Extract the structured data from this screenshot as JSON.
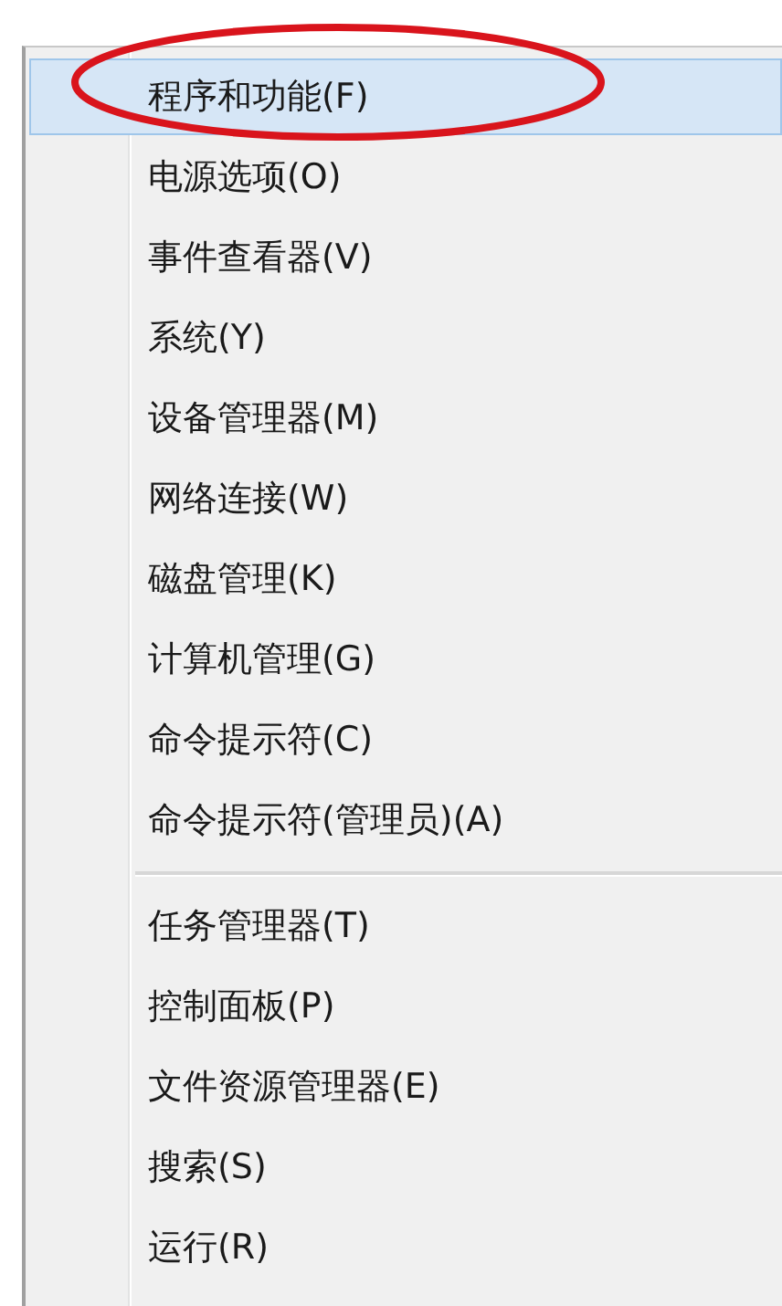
{
  "context_menu": {
    "groups": [
      {
        "items": [
          {
            "label": "程序和功能(F)",
            "selected": true,
            "circled": true
          },
          {
            "label": "电源选项(O)",
            "selected": false,
            "circled": false
          },
          {
            "label": "事件查看器(V)",
            "selected": false,
            "circled": false
          },
          {
            "label": "系统(Y)",
            "selected": false,
            "circled": false
          },
          {
            "label": "设备管理器(M)",
            "selected": false,
            "circled": false
          },
          {
            "label": "网络连接(W)",
            "selected": false,
            "circled": false
          },
          {
            "label": "磁盘管理(K)",
            "selected": false,
            "circled": false
          },
          {
            "label": "计算机管理(G)",
            "selected": false,
            "circled": false
          },
          {
            "label": "命令提示符(C)",
            "selected": false,
            "circled": false
          },
          {
            "label": "命令提示符(管理员)(A)",
            "selected": false,
            "circled": false
          }
        ]
      },
      {
        "items": [
          {
            "label": "任务管理器(T)",
            "selected": false,
            "circled": false
          },
          {
            "label": "控制面板(P)",
            "selected": false,
            "circled": false
          },
          {
            "label": "文件资源管理器(E)",
            "selected": false,
            "circled": false
          },
          {
            "label": "搜索(S)",
            "selected": false,
            "circled": false
          },
          {
            "label": "运行(R)",
            "selected": false,
            "circled": false
          }
        ]
      }
    ]
  }
}
